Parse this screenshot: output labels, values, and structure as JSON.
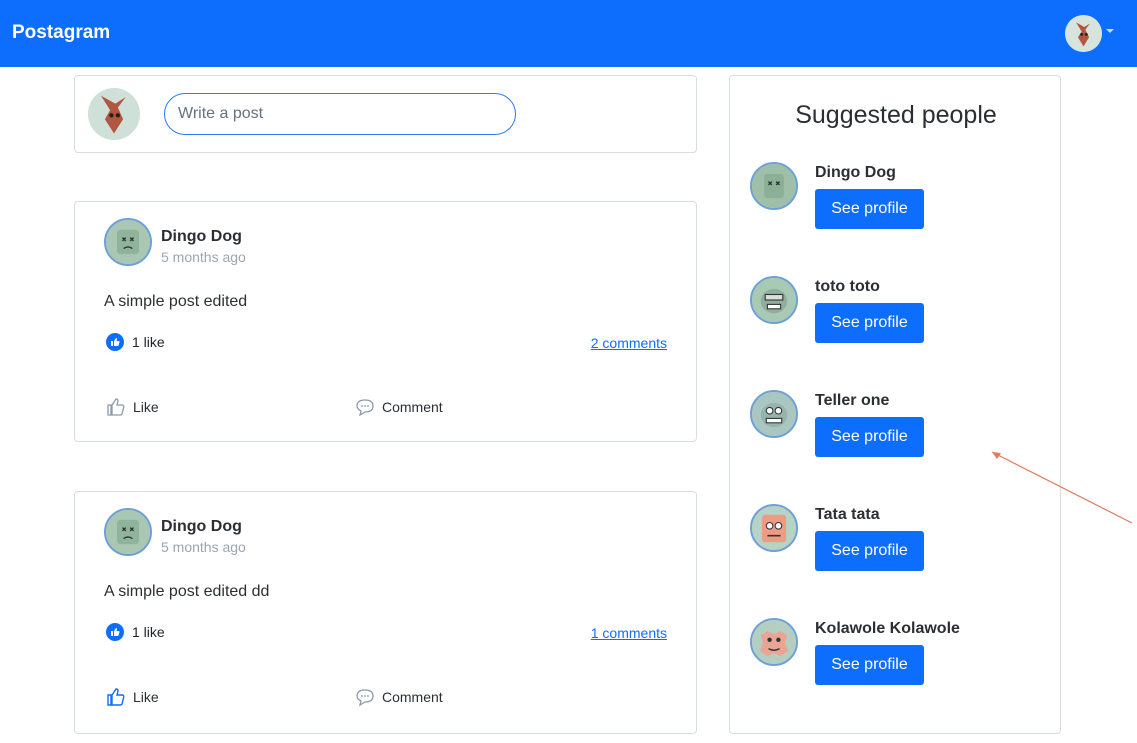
{
  "app": {
    "brand": "Postagram"
  },
  "compose": {
    "placeholder": "Write a post"
  },
  "posts": [
    {
      "author": "Dingo Dog",
      "time": "5 months ago",
      "body": "A simple post edited",
      "likes": "1 like",
      "comments": "2 comments",
      "like_label": "Like",
      "comment_label": "Comment"
    },
    {
      "author": "Dingo Dog",
      "time": "5 months ago",
      "body": "A simple post edited dd",
      "likes": "1 like",
      "comments": "1 comments",
      "like_label": "Like",
      "comment_label": "Comment"
    }
  ],
  "suggested": {
    "title": "Suggested people",
    "button_label": "See profile",
    "people": [
      {
        "name": "Dingo Dog",
        "avatar_color": "#9fbfa8"
      },
      {
        "name": "toto toto",
        "avatar_color": "#a8c9b3"
      },
      {
        "name": "Teller one",
        "avatar_color": "#aac6c0"
      },
      {
        "name": "Tata tata",
        "avatar_color": "#ee9b86"
      },
      {
        "name": "Kolawole Kolawole",
        "avatar_color": "#e9a494"
      }
    ]
  },
  "colors": {
    "primary": "#0d6efd",
    "navbar": "#0d6efd",
    "annotation_arrow": "#e07a60"
  }
}
